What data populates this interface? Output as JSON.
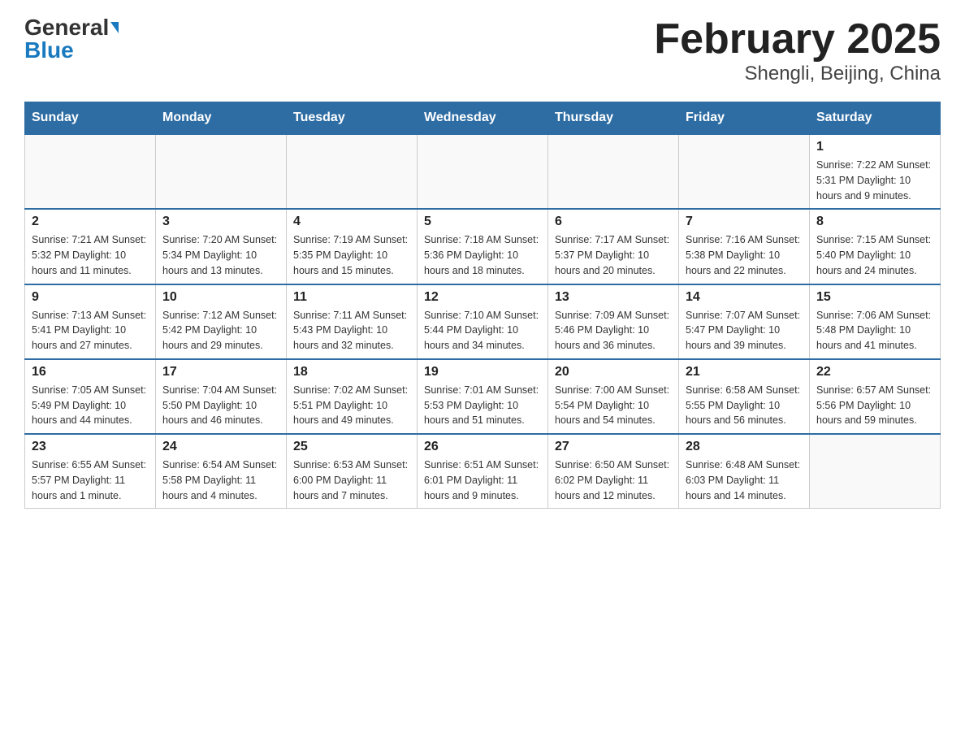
{
  "header": {
    "logo_general": "General",
    "logo_blue": "Blue",
    "title": "February 2025",
    "subtitle": "Shengli, Beijing, China"
  },
  "weekdays": [
    "Sunday",
    "Monday",
    "Tuesday",
    "Wednesday",
    "Thursday",
    "Friday",
    "Saturday"
  ],
  "weeks": [
    [
      {
        "day": "",
        "info": ""
      },
      {
        "day": "",
        "info": ""
      },
      {
        "day": "",
        "info": ""
      },
      {
        "day": "",
        "info": ""
      },
      {
        "day": "",
        "info": ""
      },
      {
        "day": "",
        "info": ""
      },
      {
        "day": "1",
        "info": "Sunrise: 7:22 AM\nSunset: 5:31 PM\nDaylight: 10 hours and 9 minutes."
      }
    ],
    [
      {
        "day": "2",
        "info": "Sunrise: 7:21 AM\nSunset: 5:32 PM\nDaylight: 10 hours and 11 minutes."
      },
      {
        "day": "3",
        "info": "Sunrise: 7:20 AM\nSunset: 5:34 PM\nDaylight: 10 hours and 13 minutes."
      },
      {
        "day": "4",
        "info": "Sunrise: 7:19 AM\nSunset: 5:35 PM\nDaylight: 10 hours and 15 minutes."
      },
      {
        "day": "5",
        "info": "Sunrise: 7:18 AM\nSunset: 5:36 PM\nDaylight: 10 hours and 18 minutes."
      },
      {
        "day": "6",
        "info": "Sunrise: 7:17 AM\nSunset: 5:37 PM\nDaylight: 10 hours and 20 minutes."
      },
      {
        "day": "7",
        "info": "Sunrise: 7:16 AM\nSunset: 5:38 PM\nDaylight: 10 hours and 22 minutes."
      },
      {
        "day": "8",
        "info": "Sunrise: 7:15 AM\nSunset: 5:40 PM\nDaylight: 10 hours and 24 minutes."
      }
    ],
    [
      {
        "day": "9",
        "info": "Sunrise: 7:13 AM\nSunset: 5:41 PM\nDaylight: 10 hours and 27 minutes."
      },
      {
        "day": "10",
        "info": "Sunrise: 7:12 AM\nSunset: 5:42 PM\nDaylight: 10 hours and 29 minutes."
      },
      {
        "day": "11",
        "info": "Sunrise: 7:11 AM\nSunset: 5:43 PM\nDaylight: 10 hours and 32 minutes."
      },
      {
        "day": "12",
        "info": "Sunrise: 7:10 AM\nSunset: 5:44 PM\nDaylight: 10 hours and 34 minutes."
      },
      {
        "day": "13",
        "info": "Sunrise: 7:09 AM\nSunset: 5:46 PM\nDaylight: 10 hours and 36 minutes."
      },
      {
        "day": "14",
        "info": "Sunrise: 7:07 AM\nSunset: 5:47 PM\nDaylight: 10 hours and 39 minutes."
      },
      {
        "day": "15",
        "info": "Sunrise: 7:06 AM\nSunset: 5:48 PM\nDaylight: 10 hours and 41 minutes."
      }
    ],
    [
      {
        "day": "16",
        "info": "Sunrise: 7:05 AM\nSunset: 5:49 PM\nDaylight: 10 hours and 44 minutes."
      },
      {
        "day": "17",
        "info": "Sunrise: 7:04 AM\nSunset: 5:50 PM\nDaylight: 10 hours and 46 minutes."
      },
      {
        "day": "18",
        "info": "Sunrise: 7:02 AM\nSunset: 5:51 PM\nDaylight: 10 hours and 49 minutes."
      },
      {
        "day": "19",
        "info": "Sunrise: 7:01 AM\nSunset: 5:53 PM\nDaylight: 10 hours and 51 minutes."
      },
      {
        "day": "20",
        "info": "Sunrise: 7:00 AM\nSunset: 5:54 PM\nDaylight: 10 hours and 54 minutes."
      },
      {
        "day": "21",
        "info": "Sunrise: 6:58 AM\nSunset: 5:55 PM\nDaylight: 10 hours and 56 minutes."
      },
      {
        "day": "22",
        "info": "Sunrise: 6:57 AM\nSunset: 5:56 PM\nDaylight: 10 hours and 59 minutes."
      }
    ],
    [
      {
        "day": "23",
        "info": "Sunrise: 6:55 AM\nSunset: 5:57 PM\nDaylight: 11 hours and 1 minute."
      },
      {
        "day": "24",
        "info": "Sunrise: 6:54 AM\nSunset: 5:58 PM\nDaylight: 11 hours and 4 minutes."
      },
      {
        "day": "25",
        "info": "Sunrise: 6:53 AM\nSunset: 6:00 PM\nDaylight: 11 hours and 7 minutes."
      },
      {
        "day": "26",
        "info": "Sunrise: 6:51 AM\nSunset: 6:01 PM\nDaylight: 11 hours and 9 minutes."
      },
      {
        "day": "27",
        "info": "Sunrise: 6:50 AM\nSunset: 6:02 PM\nDaylight: 11 hours and 12 minutes."
      },
      {
        "day": "28",
        "info": "Sunrise: 6:48 AM\nSunset: 6:03 PM\nDaylight: 11 hours and 14 minutes."
      },
      {
        "day": "",
        "info": ""
      }
    ]
  ]
}
